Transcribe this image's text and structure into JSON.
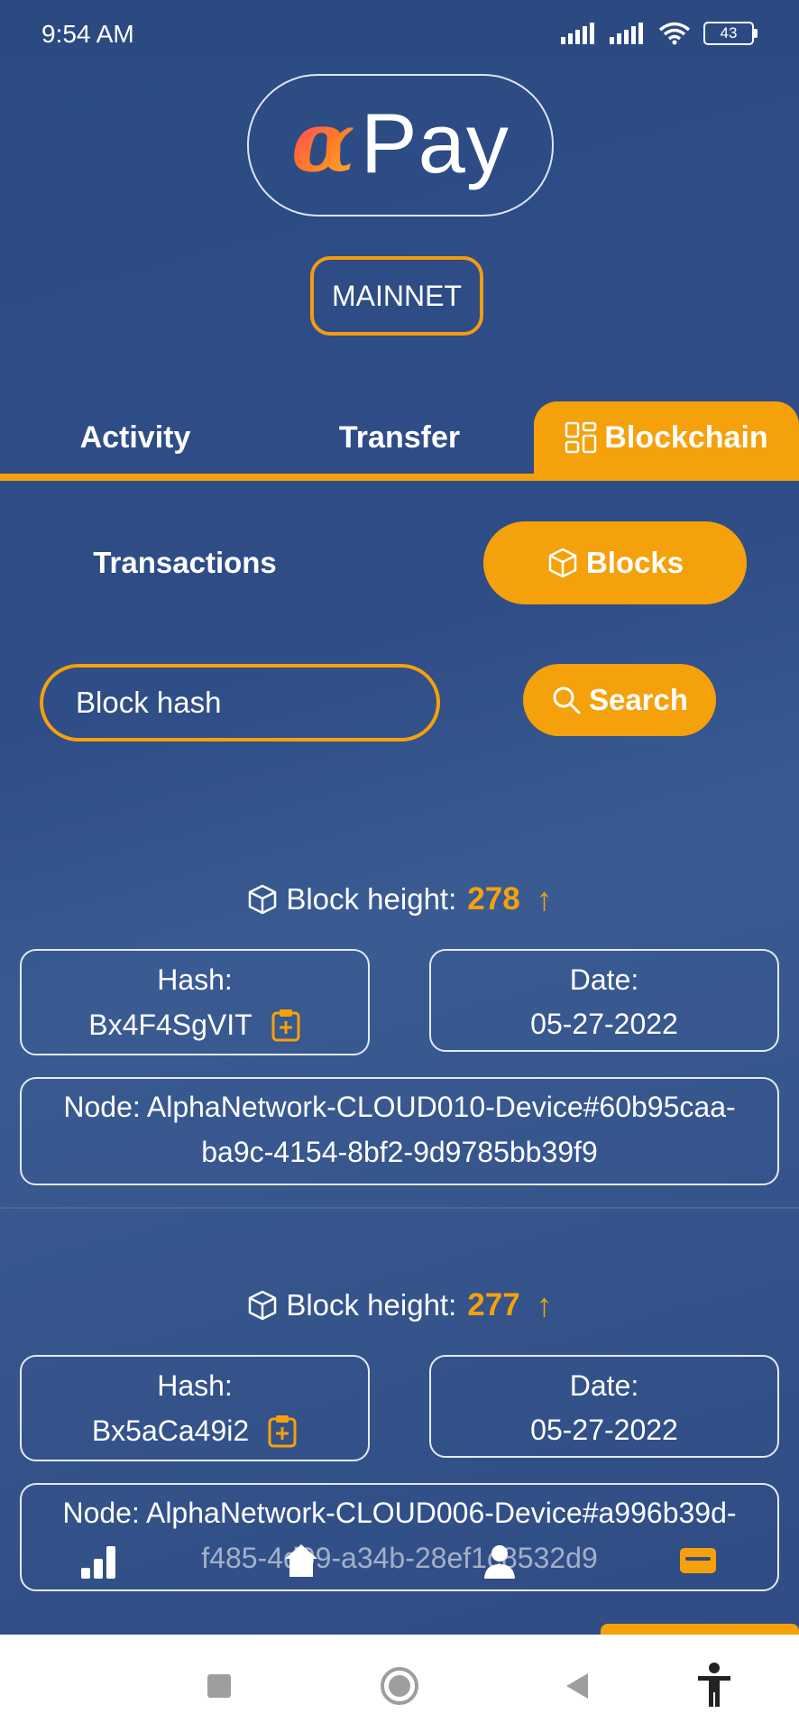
{
  "status": {
    "time": "9:54 AM",
    "battery": "43"
  },
  "logo": {
    "symbol": "α",
    "text": "Pay"
  },
  "network": "MAINNET",
  "tabs": [
    {
      "label": "Activity"
    },
    {
      "label": "Transfer"
    },
    {
      "label": "Blockchain"
    }
  ],
  "subtabs": [
    {
      "label": "Transactions"
    },
    {
      "label": "Blocks"
    }
  ],
  "search": {
    "placeholder": "Block hash",
    "button": "Search"
  },
  "blocks": [
    {
      "height_label": "Block height:",
      "height": "278",
      "hash_label": "Hash:",
      "hash": "Bx4F4SgVIT",
      "date_label": "Date:",
      "date": "05-27-2022",
      "node_line1": "Node: AlphaNetwork-CLOUD010-Device#60b95caa-",
      "node_line2": "ba9c-4154-8bf2-9d9785bb39f9"
    },
    {
      "height_label": "Block height:",
      "height": "277",
      "hash_label": "Hash:",
      "hash": "Bx5aCa49i2",
      "date_label": "Date:",
      "date": "05-27-2022",
      "node_line1": "Node: AlphaNetwork-CLOUD006-Device#a996b39d-",
      "node_line2": "f485-4d09-a34b-28ef1c8532d9"
    }
  ],
  "colors": {
    "accent": "#f5a10b",
    "background": "#2f4d86"
  }
}
